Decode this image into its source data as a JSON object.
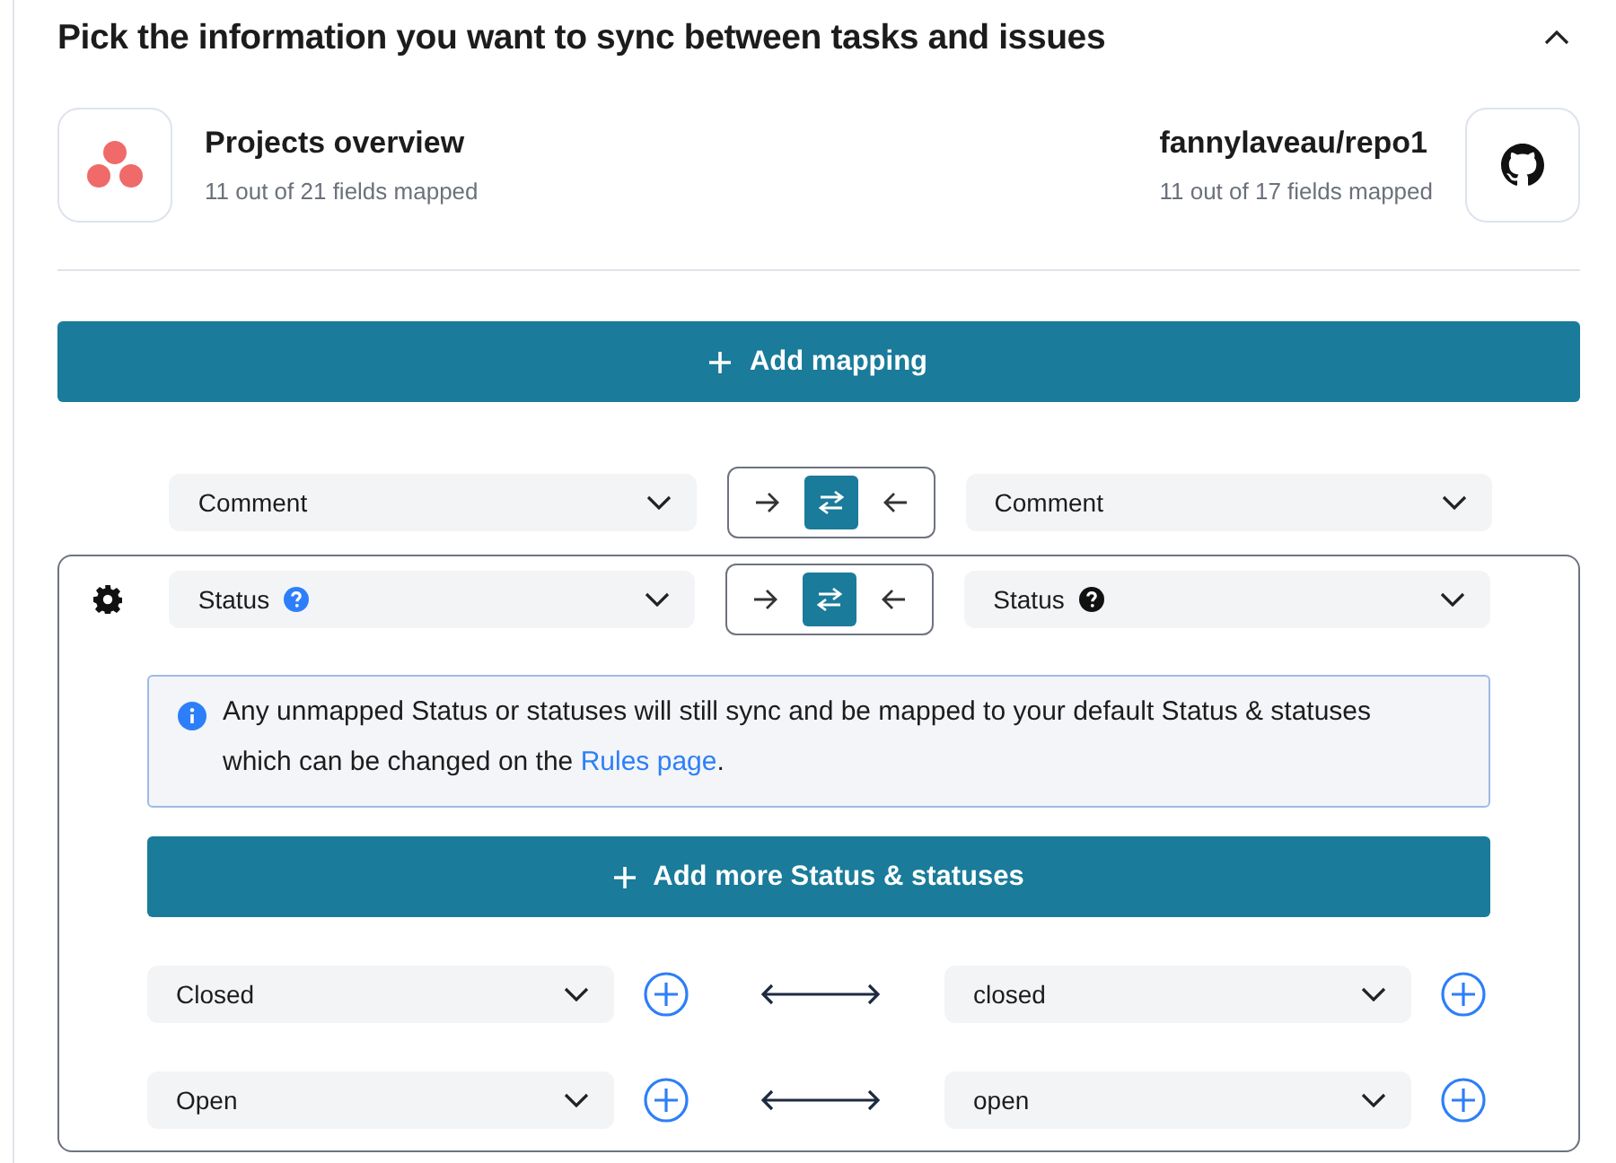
{
  "section": {
    "title": "Pick the information you want to sync between tasks and issues",
    "expanded": true
  },
  "left_project": {
    "name": "Projects overview",
    "fields_mapped": "11 out of 21 fields mapped"
  },
  "right_project": {
    "name": "fannylaveau/repo1",
    "fields_mapped": "11 out of 17 fields mapped"
  },
  "add_mapping": {
    "label": "Add mapping"
  },
  "mappings": [
    {
      "left": {
        "value": "Comment",
        "help": false
      },
      "direction": [
        {
          "kind": "to-right",
          "selected": false
        },
        {
          "kind": "both",
          "selected": true
        },
        {
          "kind": "to-left",
          "selected": false
        }
      ],
      "right": {
        "value": "Comment",
        "help": false
      },
      "expanded": false
    },
    {
      "left": {
        "value": "Status",
        "help": true
      },
      "direction": [
        {
          "kind": "to-right",
          "selected": false
        },
        {
          "kind": "both",
          "selected": true
        },
        {
          "kind": "to-left",
          "selected": false
        }
      ],
      "right": {
        "value": "Status",
        "help": true
      },
      "expanded": true,
      "info": {
        "text": "Any unmapped Status or statuses will still sync and be mapped to your default Status & statuses which can be changed on the ",
        "link": "Rules page",
        "end": "."
      },
      "add_more": "Add more Status & statuses",
      "value_pairs": [
        {
          "left": "Closed",
          "right": "closed"
        },
        {
          "left": "Open",
          "right": "open"
        }
      ]
    }
  ]
}
